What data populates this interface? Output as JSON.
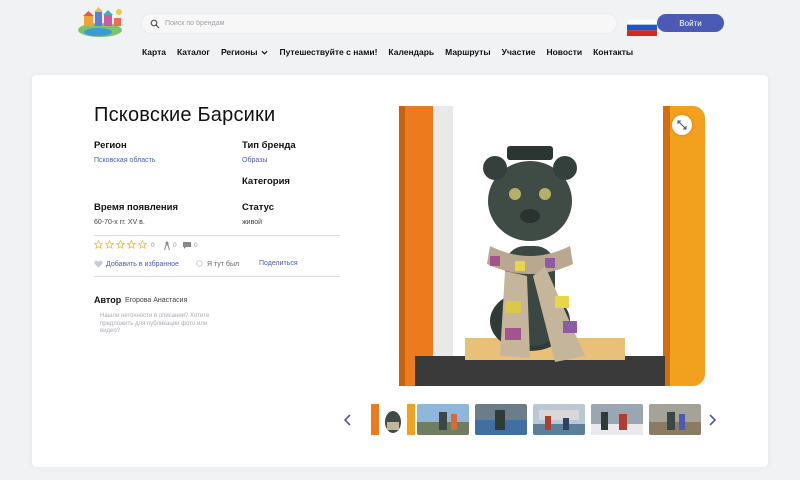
{
  "header": {
    "logo_icon": "site-logo",
    "search": {
      "placeholder": "Поиск по брендам",
      "icon": "search-icon"
    },
    "language_flag": "russian-flag-icon",
    "login_label": "Войти",
    "nav": [
      {
        "label": "Карта"
      },
      {
        "label": "Каталог"
      },
      {
        "label": "Регионы",
        "has_dropdown": true
      },
      {
        "label": "Путешествуйте с нами!"
      },
      {
        "label": "Календарь"
      },
      {
        "label": "Маршруты"
      },
      {
        "label": "Участие"
      },
      {
        "label": "Новости"
      },
      {
        "label": "Контакты"
      }
    ]
  },
  "brand": {
    "title": "Псковские Барсики",
    "region_label": "Регион",
    "region_value": "Псковская область",
    "type_label": "Тип бренда",
    "type_value": "Образы",
    "category_label": "Категория",
    "time_label": "Время появления",
    "time_value": "60-70-х гг. XV в.",
    "status_label": "Статус",
    "status_value": "живой"
  },
  "stats": {
    "rating_count": "0",
    "visits_count": "0",
    "comments_count": "0"
  },
  "actions": {
    "favorite": "Добавить в избранное",
    "been_here": "Я тут был",
    "share": "Поделиться"
  },
  "author": {
    "label": "Автор",
    "name": "Егорова Анастасия"
  },
  "note": "Нашли неточности в описании? Хотите предложить для публикации фото или видео?",
  "colors": {
    "accent": "#4b5ab3",
    "background": "#f1f2f4",
    "card": "#ffffff",
    "star_outline": "#f0b429"
  },
  "gallery": {
    "thumbnail_count": 6
  }
}
